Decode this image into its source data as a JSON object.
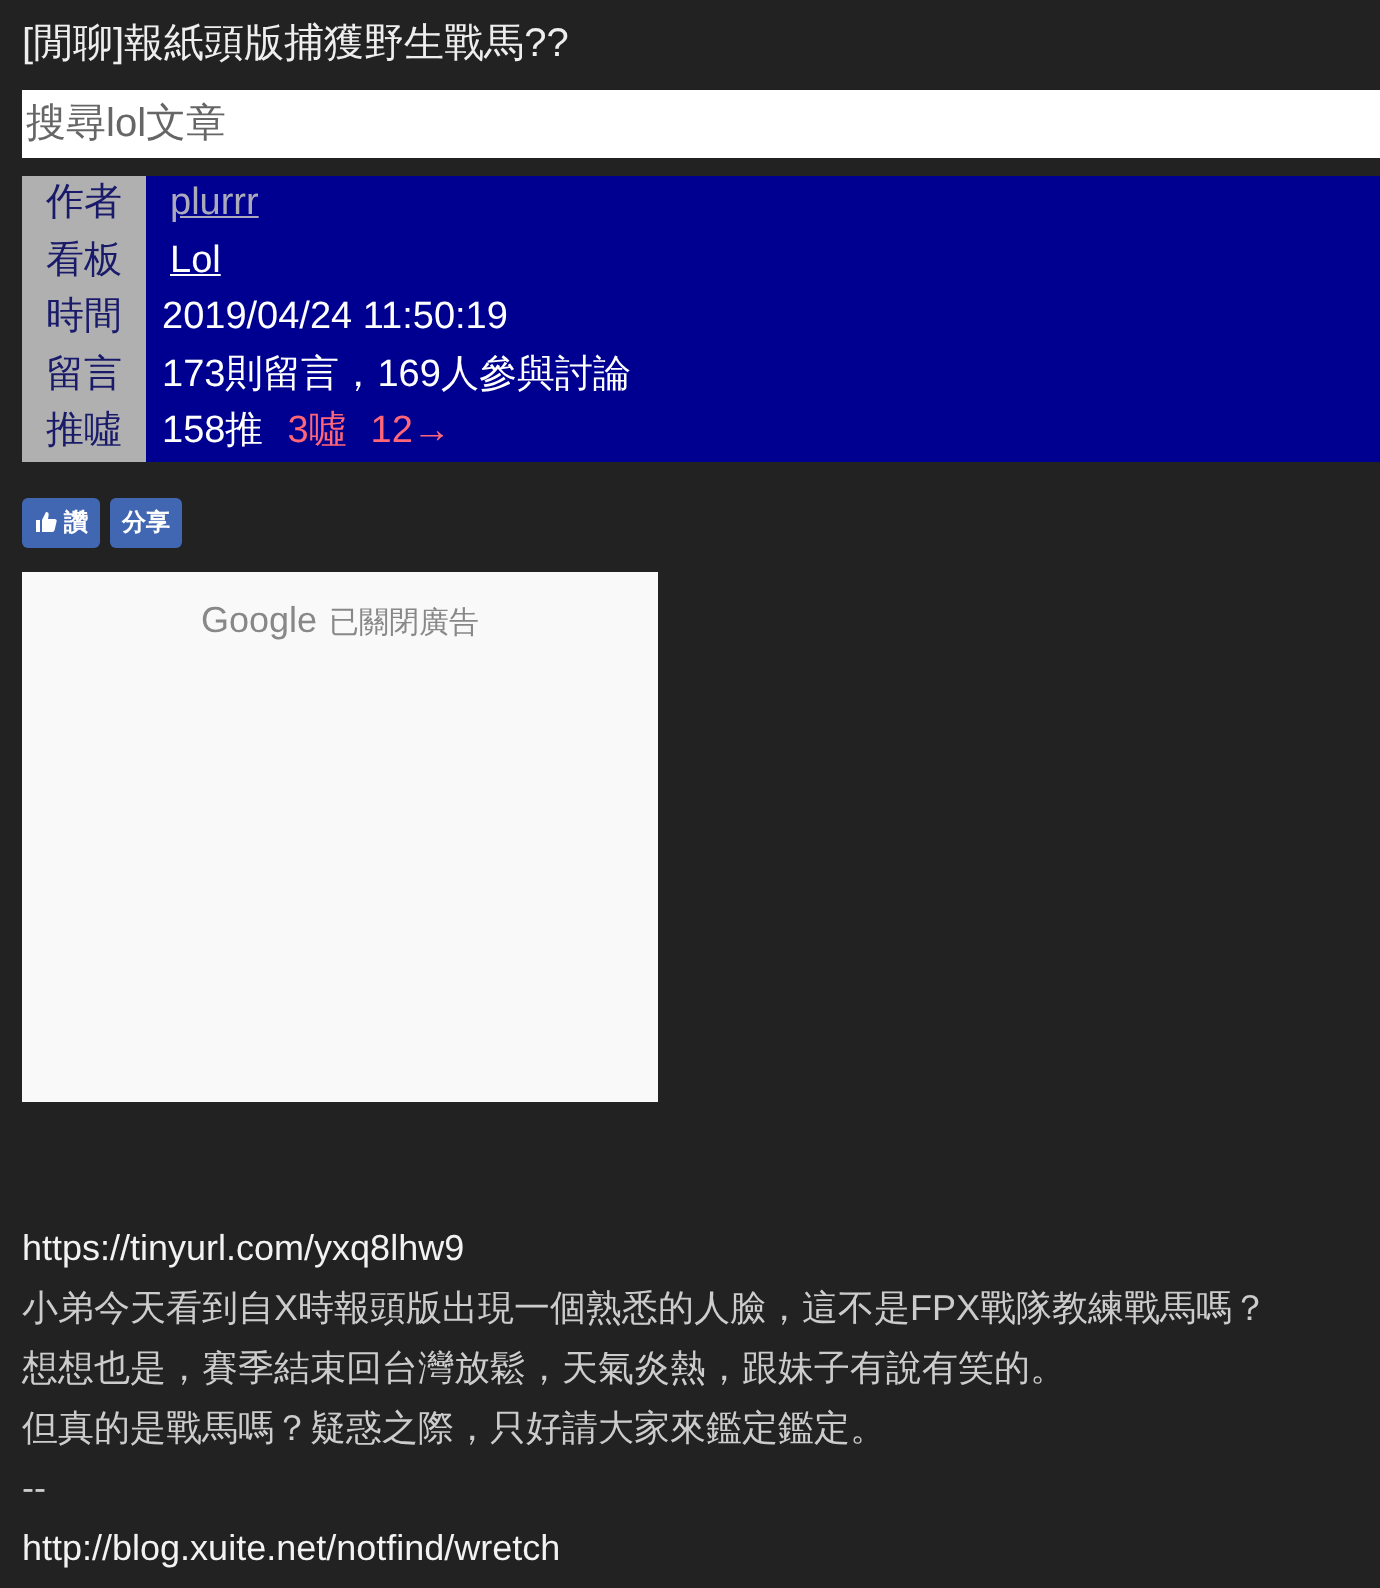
{
  "title": "[閒聊]報紙頭版捕獲野生戰馬??",
  "search": {
    "placeholder": "搜尋lol文章"
  },
  "meta": [
    {
      "label": "作者",
      "kind": "link",
      "value": "plurrr",
      "visited": true
    },
    {
      "label": "看板",
      "kind": "link",
      "value": "Lol",
      "visited": false
    },
    {
      "label": "時間",
      "kind": "text",
      "value": "2019/04/24 11:50:19"
    },
    {
      "label": "留言",
      "kind": "text",
      "value": "173則留言，169人參與討論"
    },
    {
      "label": "推噓",
      "kind": "votes",
      "votes": [
        {
          "text": "158推",
          "color": "#ffffff"
        },
        {
          "text": "3噓",
          "color": "#ff6677"
        },
        {
          "text": "12→",
          "color": "#ff6677"
        }
      ]
    }
  ],
  "buttons": [
    {
      "kind": "like",
      "label": "讚"
    },
    {
      "kind": "share",
      "label": "分享"
    }
  ],
  "ad": {
    "brand": "Google",
    "text": "已關閉廣告"
  },
  "article": [
    {
      "kind": "link",
      "text": "https://tinyurl.com/yxq8lhw9"
    },
    {
      "kind": "text",
      "text": "小弟今天看到自X時報頭版出現一個熟悉的人臉，這不是FPX戰隊教練戰馬嗎？"
    },
    {
      "kind": "text",
      "text": "想想也是，賽季結束回台灣放鬆，天氣炎熱，跟妹子有說有笑的。"
    },
    {
      "kind": "text",
      "text": "但真的是戰馬嗎？疑惑之際，只好請大家來鑑定鑑定。"
    },
    {
      "kind": "text",
      "text": "--"
    },
    {
      "kind": "link",
      "text": "http://blog.xuite.net/notfind/wretch"
    }
  ]
}
